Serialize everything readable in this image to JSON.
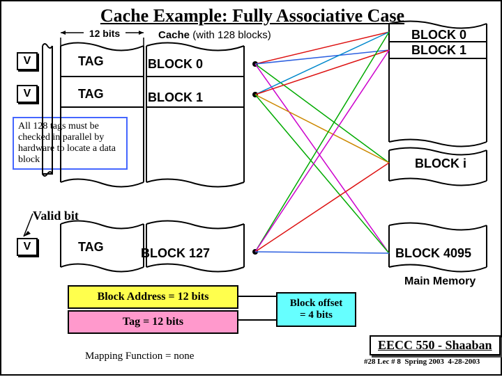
{
  "title": "Cache Example: Fully Associative Case",
  "top": {
    "bits12": "12 bits",
    "cache_bold": "Cache",
    "cache_rest": " (with 128 blocks)"
  },
  "cache": {
    "V": "V",
    "TAG": "TAG",
    "blocks": [
      "BLOCK 0",
      "BLOCK 1",
      "BLOCK 127"
    ]
  },
  "mem": {
    "blocks": [
      "BLOCK 0",
      "BLOCK 1",
      "BLOCK i",
      "BLOCK 4095"
    ],
    "label": "Main Memory"
  },
  "note": "All 128 tags must be checked in parallel by hardware to locate a data block",
  "valid_bit": "Valid bit",
  "addr": {
    "block_addr": "Block Address  =  12 bits",
    "tag": "Tag  =  12 bits",
    "offset_l1": "Block offset",
    "offset_l2": "= 4 bits"
  },
  "map_fn": "Mapping Function = none",
  "footer": {
    "course": "EECC 550 - Shaaban",
    "lec": "#28  Lec # 8",
    "term": "Spring 2003",
    "date": "4-28-2003"
  }
}
